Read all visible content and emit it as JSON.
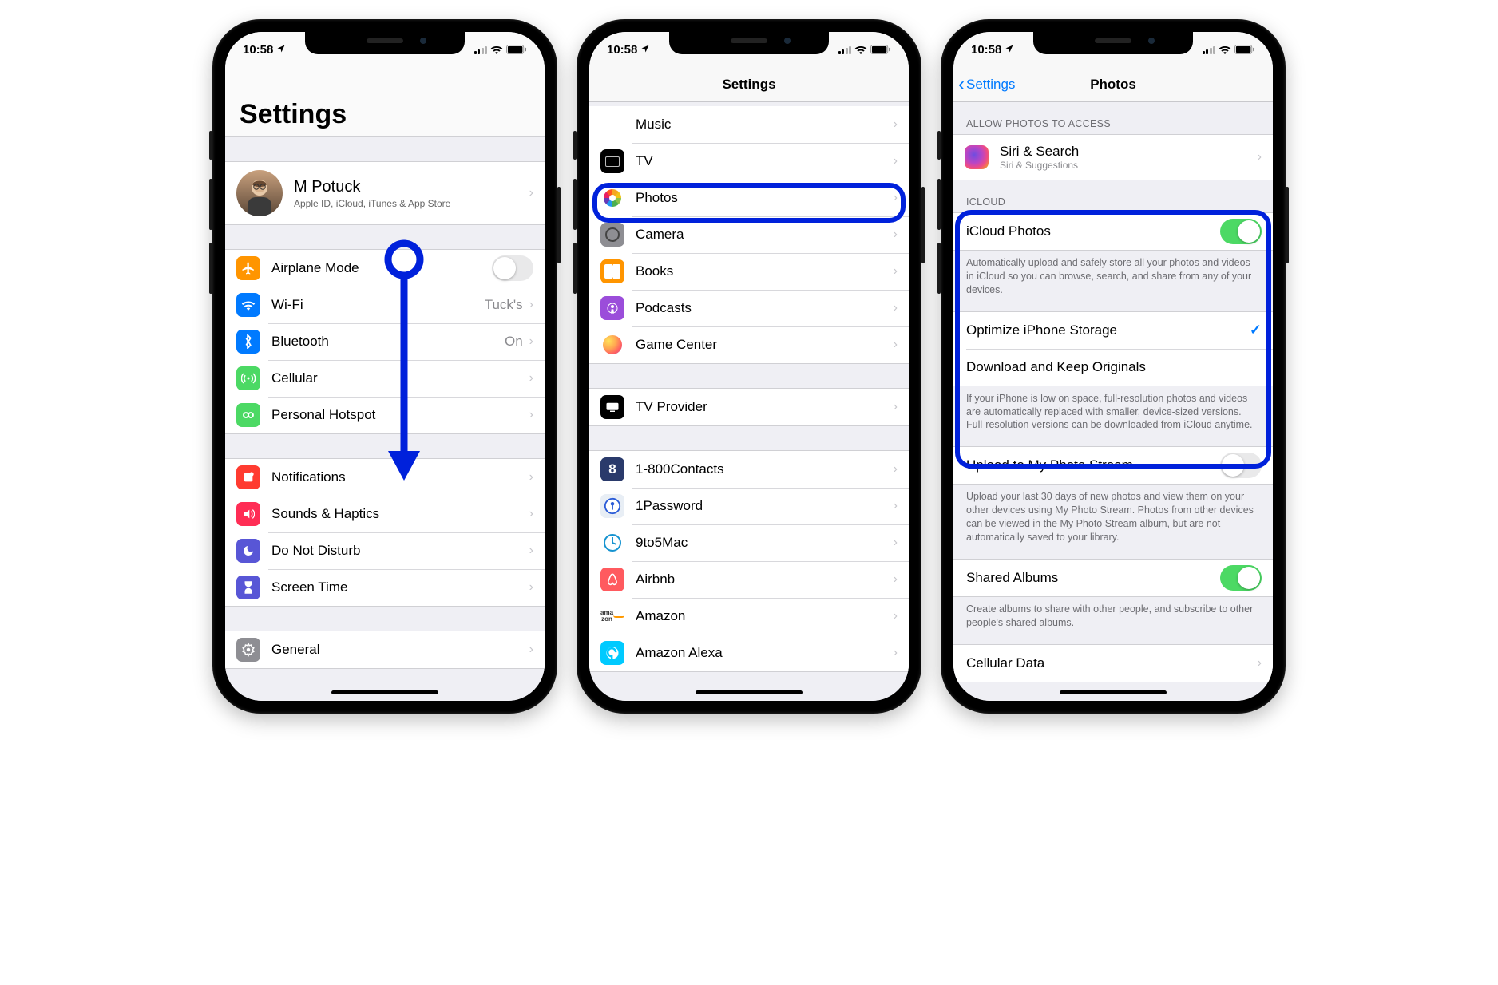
{
  "status": {
    "time": "10:58"
  },
  "screen1": {
    "title": "Settings",
    "profile": {
      "name": "M Potuck",
      "sub": "Apple ID, iCloud, iTunes & App Store"
    },
    "group_net": {
      "airplane": "Airplane Mode",
      "wifi": "Wi-Fi",
      "wifi_val": "Tuck's",
      "bt": "Bluetooth",
      "bt_val": "On",
      "cell": "Cellular",
      "hotspot": "Personal Hotspot"
    },
    "group_sys": {
      "notif": "Notifications",
      "sounds": "Sounds & Haptics",
      "dnd": "Do Not Disturb",
      "screentime": "Screen Time"
    },
    "group_gen": {
      "general": "General"
    }
  },
  "screen2": {
    "title": "Settings",
    "group_apple": {
      "music": "Music",
      "tv": "TV",
      "photos": "Photos",
      "camera": "Camera",
      "books": "Books",
      "podcasts": "Podcasts",
      "gamectr": "Game Center"
    },
    "group_tv": {
      "tvprov": "TV Provider"
    },
    "group_apps": {
      "a1": "1-800Contacts",
      "a2": "1Password",
      "a3": "9to5Mac",
      "a4": "Airbnb",
      "a5": "Amazon",
      "a6": "Amazon Alexa"
    }
  },
  "screen3": {
    "back": "Settings",
    "title": "Photos",
    "sect_allow": "ALLOW PHOTOS TO ACCESS",
    "siri": "Siri & Search",
    "siri_sub": "Siri & Suggestions",
    "sect_icloud": "ICLOUD",
    "icloud_photos": "iCloud Photos",
    "icloud_footer": "Automatically upload and safely store all your photos and videos in iCloud so you can browse, search, and share from any of your devices.",
    "optimize": "Optimize iPhone Storage",
    "download": "Download and Keep Originals",
    "storage_footer": "If your iPhone is low on space, full-resolution photos and videos are automatically replaced with smaller, device-sized versions. Full-resolution versions can be downloaded from iCloud anytime.",
    "photostream": "Upload to My Photo Stream",
    "photostream_footer": "Upload your last 30 days of new photos and view them on your other devices using My Photo Stream. Photos from other devices can be viewed in the My Photo Stream album, but are not automatically saved to your library.",
    "shared": "Shared Albums",
    "shared_footer": "Create albums to share with other people, and subscribe to other people's shared albums.",
    "cellular": "Cellular Data"
  }
}
